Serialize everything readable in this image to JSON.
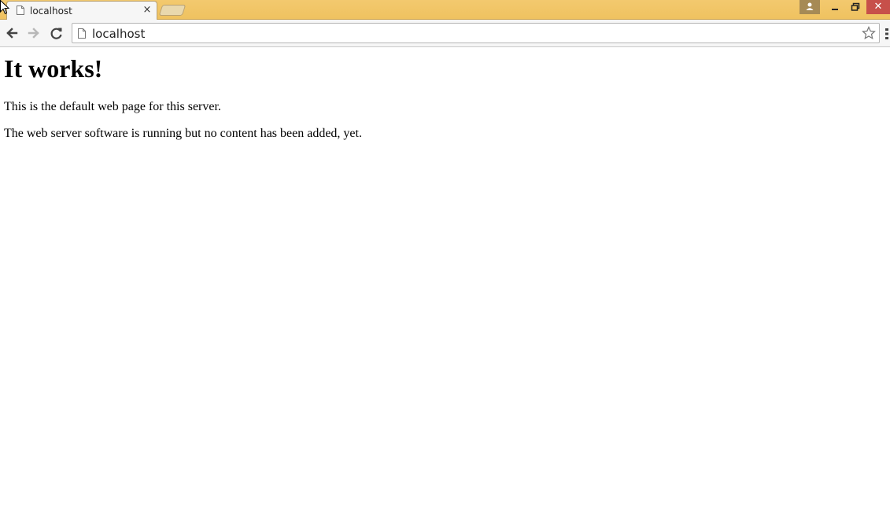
{
  "browser": {
    "tab": {
      "title": "localhost",
      "close_label": "×"
    },
    "window_controls": {
      "close_label": "✕"
    },
    "address_bar": {
      "url": "localhost"
    },
    "icons": {
      "tab_favicon": "page-icon",
      "back": "back-arrow-icon",
      "forward": "forward-arrow-icon",
      "reload": "reload-icon",
      "bookmark": "star-icon",
      "menu": "menu-icon",
      "profile": "person-icon"
    },
    "colors": {
      "titlebar": "#efc260",
      "close_button": "#c7504a"
    }
  },
  "page": {
    "heading": "It works!",
    "paragraphs": [
      "This is the default web page for this server.",
      "The web server software is running but no content has been added, yet."
    ]
  }
}
